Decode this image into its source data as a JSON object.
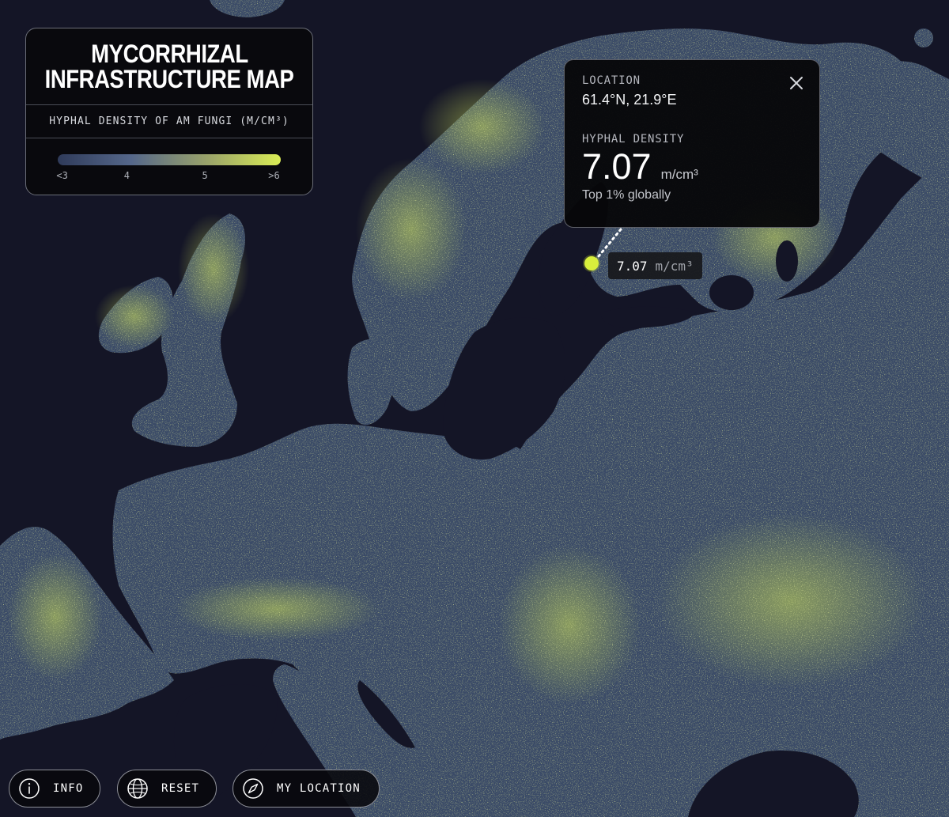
{
  "legend": {
    "title_line1": "MYCORRHIZAL",
    "title_line2": "INFRASTRUCTURE MAP",
    "subtitle": "HYPHAL DENSITY OF AM FUNGI (M/CM³)",
    "ticks": [
      "<3",
      "4",
      "5",
      ">6"
    ],
    "gradient_colors": [
      "#2f3b5a",
      "#55678a",
      "#9aa36a",
      "#d9ec55"
    ]
  },
  "popup": {
    "location_label": "LOCATION",
    "coordinates": "61.4°N, 21.9°E",
    "density_label": "HYPHAL DENSITY",
    "density_value": "7.07",
    "density_unit": "m/cm³",
    "rank_text": "Top 1% globally",
    "close_icon": "close-icon"
  },
  "marker": {
    "value": "7.07",
    "unit": "m/cm³",
    "color": "#d8ef3c"
  },
  "controls": {
    "info_label": "INFO",
    "reset_label": "RESET",
    "location_label": "MY LOCATION"
  },
  "colors": {
    "ocean": "#141526",
    "land_low": "#2f3b5a",
    "land_high": "#d9ec55",
    "accent": "#d8ef3c"
  }
}
